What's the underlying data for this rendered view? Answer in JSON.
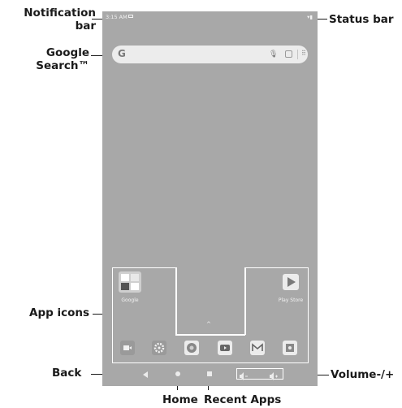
{
  "labels": {
    "notification_bar": "Notification bar",
    "status_bar": "Status bar",
    "google_search": "Google Search™",
    "app_icons": "App icons",
    "back": "Back",
    "volume": "Volume-/+",
    "home": "Home",
    "recent_apps": "Recent Apps"
  },
  "phone": {
    "status_time": "3:15 AM",
    "folder_label": "Google",
    "playstore_label": "Play Store",
    "search_logo": "G"
  }
}
